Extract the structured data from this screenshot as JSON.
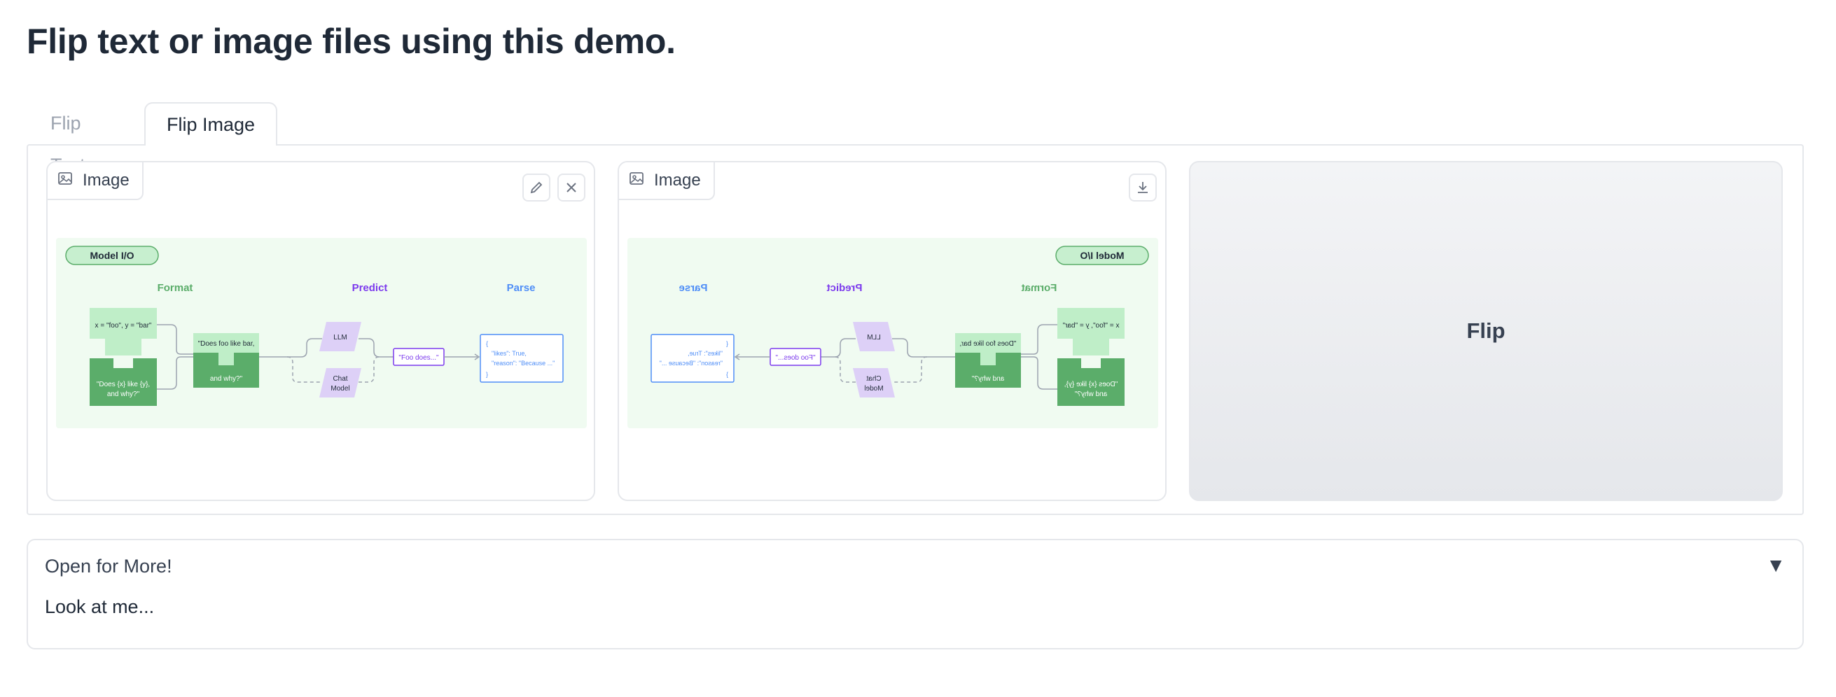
{
  "page": {
    "title": "Flip text or image files using this demo."
  },
  "tabs": [
    {
      "label": "Flip Text",
      "active": false
    },
    {
      "label": "Flip Image",
      "active": true
    }
  ],
  "input_image": {
    "label": "Image",
    "icon": "image-icon",
    "actions": [
      "edit-icon",
      "close-icon"
    ]
  },
  "output_image": {
    "label": "Image",
    "icon": "image-icon",
    "actions": [
      "download-icon"
    ]
  },
  "diagram": {
    "badge": "Model I/O",
    "sections": {
      "format": "Format",
      "predict": "Predict",
      "parse": "Parse"
    },
    "format_top": "x = \"foo\", y = \"bar\"",
    "format_left": [
      "\"Does {x} like {y},",
      "and why?\""
    ],
    "format_mid": [
      "\"Does foo like bar,",
      "and why?\""
    ],
    "llm": "LLM",
    "chat_model": [
      "Chat",
      "Model"
    ],
    "output": "\"Foo does...\"",
    "parse_out": [
      "{",
      "\"likes\": True,",
      "\"reason\": \"Because ...\"",
      "}"
    ],
    "colors": {
      "background": "#f0fbf1",
      "green_light": "#bfeec8",
      "green_dark": "#5bad6a",
      "purple": "#ddd0f7",
      "purple_text": "#7c3aed",
      "blue": "#4f8ef7",
      "badge_fill": "#c7efcf"
    }
  },
  "flip_button": {
    "label": "Flip"
  },
  "accordion": {
    "title": "Open for More!",
    "body": "Look at me...",
    "arrow": "▼"
  }
}
